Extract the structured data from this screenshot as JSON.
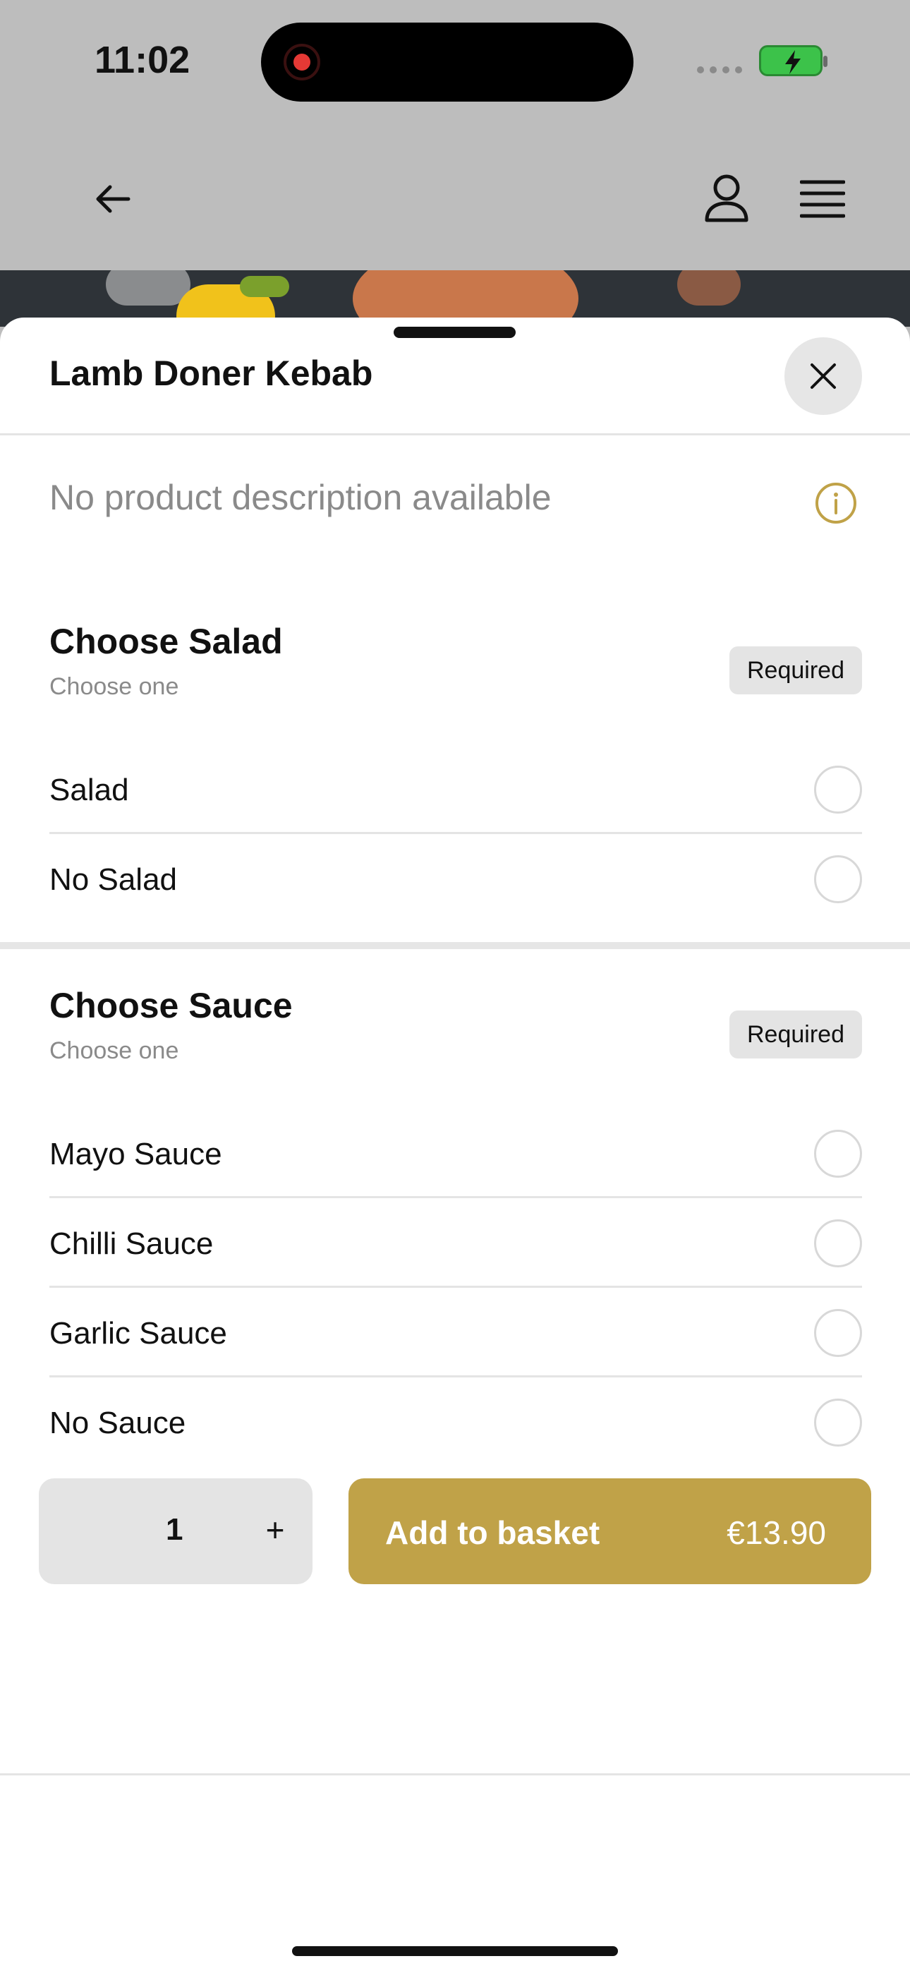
{
  "status_bar": {
    "time": "11:02"
  },
  "sheet": {
    "title": "Lamb Doner Kebab",
    "description": "No product description available"
  },
  "sections": [
    {
      "title": "Choose Salad",
      "subtitle": "Choose one",
      "badge": "Required",
      "options": [
        {
          "label": "Salad"
        },
        {
          "label": "No Salad"
        }
      ]
    },
    {
      "title": "Choose Sauce",
      "subtitle": "Choose one",
      "badge": "Required",
      "options": [
        {
          "label": "Mayo Sauce"
        },
        {
          "label": "Chilli Sauce"
        },
        {
          "label": "Garlic Sauce"
        },
        {
          "label": "No Sauce"
        }
      ]
    }
  ],
  "footer": {
    "quantity": "1",
    "plus_label": "+",
    "add_label": "Add to basket",
    "price": "€13.90"
  },
  "colors": {
    "accent": "#c0a248",
    "info_icon": "#c0a248",
    "battery": "#3cc24a"
  },
  "icons": [
    "back-arrow",
    "user",
    "hamburger-menu",
    "close",
    "info",
    "record",
    "battery-charging"
  ]
}
